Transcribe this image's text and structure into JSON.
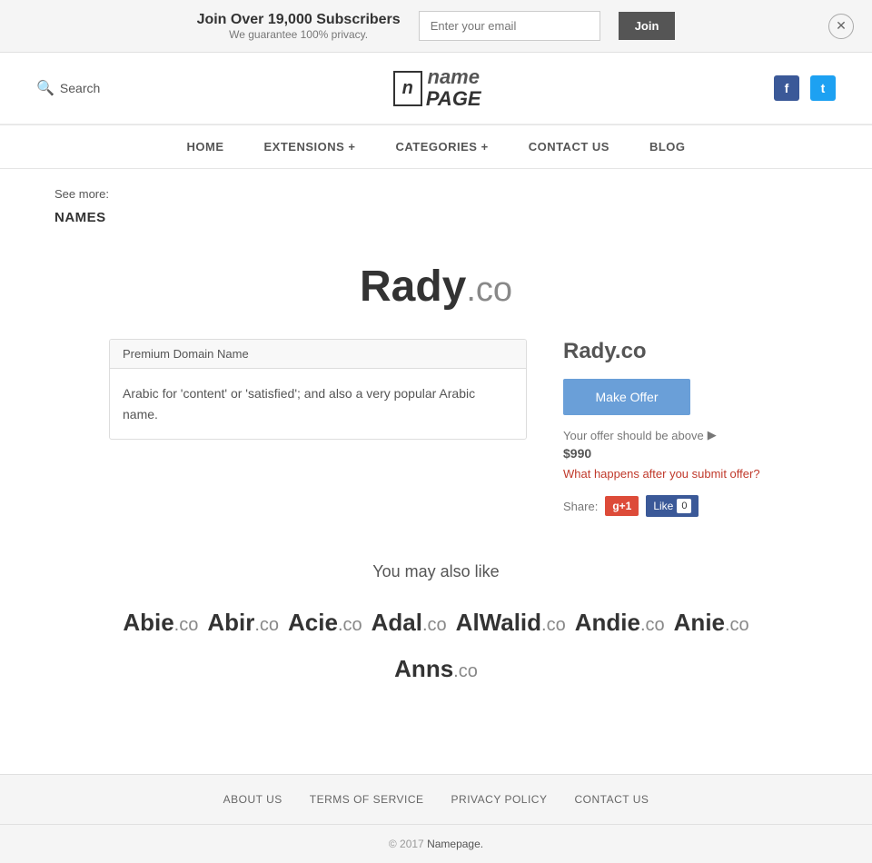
{
  "banner": {
    "title": "Join Over 19,000 Subscribers",
    "subtitle": "We guarantee 100% privacy.",
    "email_placeholder": "Enter your email",
    "join_label": "Join"
  },
  "header": {
    "search_label": "Search",
    "logo_icon": "n",
    "logo_name": "name",
    "logo_page": "PAGE"
  },
  "nav": {
    "items": [
      {
        "label": "HOME",
        "id": "home"
      },
      {
        "label": "EXTENSIONS +",
        "id": "extensions"
      },
      {
        "label": "CATEGORIES +",
        "id": "categories"
      },
      {
        "label": "CONTACT US",
        "id": "contact"
      },
      {
        "label": "BLOG",
        "id": "blog"
      }
    ]
  },
  "breadcrumb": {
    "see_more": "See more:",
    "category": "NAMES"
  },
  "domain": {
    "name": "Rady",
    "tld": ".co",
    "full": "Rady.co",
    "tab_label": "Premium Domain Name",
    "description": "Arabic for 'content' or 'satisfied'; and also a very popular Arabic name.",
    "offer_hint": "Your offer should be above",
    "offer_price": "$990",
    "offer_link": "What happens after you submit offer?",
    "make_offer_label": "Make Offer",
    "share_label": "Share:",
    "gplus_label": "g+1",
    "fb_like_label": "Like",
    "fb_count": "0"
  },
  "also_like": {
    "title": "You may also like",
    "domains": [
      {
        "name": "Abie",
        "tld": ".co"
      },
      {
        "name": "Abir",
        "tld": ".co"
      },
      {
        "name": "Acie",
        "tld": ".co"
      },
      {
        "name": "Adal",
        "tld": ".co"
      },
      {
        "name": "AlWalid",
        "tld": ".co"
      },
      {
        "name": "Andie",
        "tld": ".co"
      },
      {
        "name": "Anie",
        "tld": ".co"
      },
      {
        "name": "Anns",
        "tld": ".co"
      }
    ]
  },
  "footer": {
    "links": [
      {
        "label": "ABOUT US",
        "id": "about"
      },
      {
        "label": "TERMS OF SERVICE",
        "id": "terms"
      },
      {
        "label": "PRIVACY POLICY",
        "id": "privacy"
      },
      {
        "label": "CONTACT US",
        "id": "contact"
      }
    ],
    "copyright": "© 2017",
    "brand": "Namepage."
  }
}
